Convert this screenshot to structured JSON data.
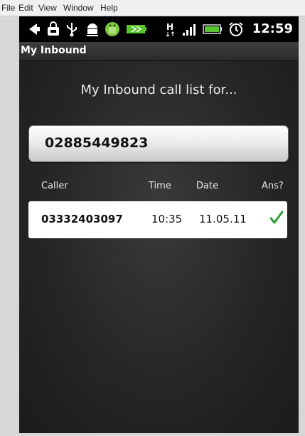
{
  "menubar": {
    "items": [
      "File",
      "Edit",
      "View",
      "Window",
      "Help"
    ]
  },
  "status": {
    "time": "12:59",
    "network": "H"
  },
  "title": "My Inbound",
  "heading": "My Inbound call list for...",
  "number": "02885449823",
  "columns": {
    "caller": "Caller",
    "time": "Time",
    "date": "Date",
    "answered": "Ans?"
  },
  "calls": [
    {
      "caller": "03332403097",
      "time": "10:35",
      "date": "11.05.11",
      "answered": true
    }
  ],
  "colors": {
    "check": "#2e9e2e",
    "battery": "#59c42d"
  }
}
